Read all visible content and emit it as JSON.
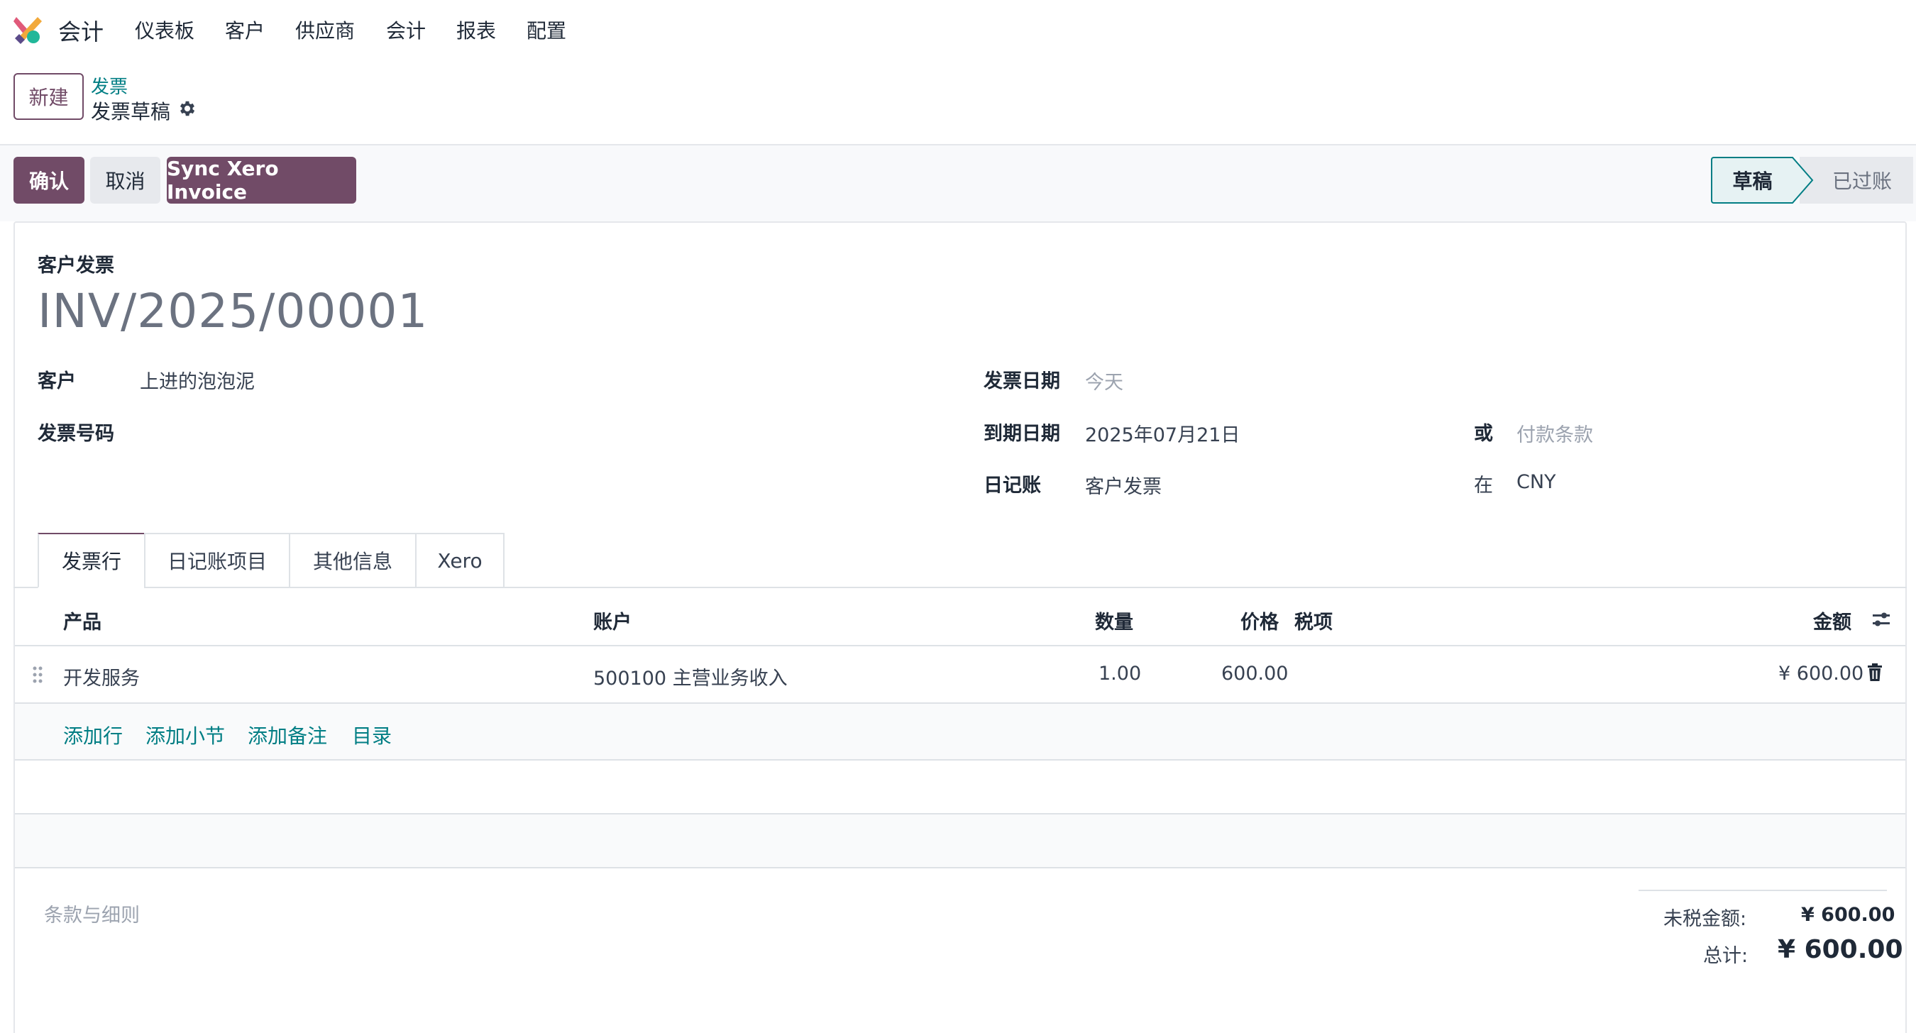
{
  "nav": {
    "app_name": "会计",
    "items": [
      "仪表板",
      "客户",
      "供应商",
      "会计",
      "报表",
      "配置"
    ]
  },
  "control_panel": {
    "new_button": "新建",
    "breadcrumb_parent": "发票",
    "breadcrumb_current": "发票草稿"
  },
  "actions": {
    "confirm": "确认",
    "cancel": "取消",
    "sync": "Sync Xero Invoice"
  },
  "status": {
    "stages": [
      "草稿",
      "已过账"
    ],
    "active": "草稿"
  },
  "invoice": {
    "type": "客户发票",
    "number": "INV/2025/00001",
    "customer_label": "客户",
    "customer_value": "上进的泡泡泥",
    "invoice_ref_label": "发票号码",
    "invoice_date_label": "发票日期",
    "invoice_date_placeholder": "今天",
    "due_date_label": "到期日期",
    "due_date_value": "2025年07月21日",
    "or_label": "或",
    "payment_terms_placeholder": "付款条款",
    "journal_label": "日记账",
    "journal_value": "客户发票",
    "in_label": "在",
    "currency_value": "CNY"
  },
  "tabs": [
    "发票行",
    "日记账项目",
    "其他信息",
    "Xero"
  ],
  "table": {
    "headers": {
      "product": "产品",
      "account": "账户",
      "quantity": "数量",
      "price": "价格",
      "taxes": "税项",
      "amount": "金额"
    },
    "rows": [
      {
        "product": "开发服务",
        "account": "500100 主营业务收入",
        "quantity": "1.00",
        "price": "600.00",
        "amount": "¥ 600.00"
      }
    ],
    "add_links": [
      "添加行",
      "添加小节",
      "添加备注",
      "目录"
    ]
  },
  "footer": {
    "terms_placeholder": "条款与细则",
    "untaxed_label": "未税金额:",
    "untaxed_value": "¥ 600.00",
    "total_label": "总计:",
    "total_value": "¥ 600.00"
  },
  "colors": {
    "brand": "#714b67",
    "link": "#017e84"
  }
}
